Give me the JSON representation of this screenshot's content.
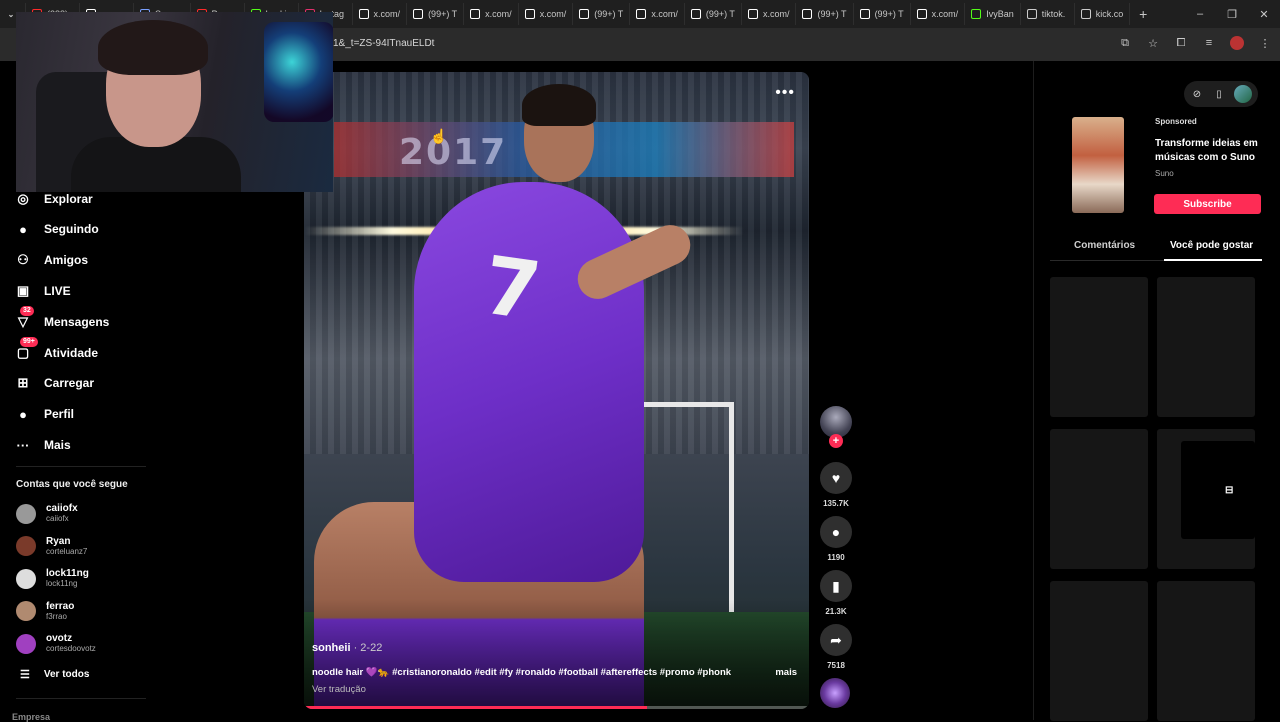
{
  "browser": {
    "tabs": [
      {
        "label": "(288)",
        "icon": "youtube-icon",
        "color": "#ff2a2a"
      },
      {
        "label": "",
        "icon": "tiktok-icon",
        "color": "#ffffff"
      },
      {
        "label": "Screen",
        "icon": "generic-icon",
        "color": "#7aa0ff"
      },
      {
        "label": "Provo",
        "icon": "youtube-icon",
        "color": "#ff2a2a"
      },
      {
        "label": "Lockin",
        "icon": "kick-icon",
        "color": "#53fc18"
      },
      {
        "label": "Instag",
        "icon": "instagram-icon",
        "color": "#e1306c"
      },
      {
        "label": "x.com/",
        "icon": "x-icon",
        "color": "#ffffff"
      },
      {
        "label": "(99+) T",
        "icon": "tiktok-icon",
        "color": "#ffffff"
      },
      {
        "label": "x.com/",
        "icon": "x-icon",
        "color": "#ffffff"
      },
      {
        "label": "x.com/",
        "icon": "x-icon",
        "color": "#ffffff"
      },
      {
        "label": "(99+) T",
        "icon": "tiktok-icon",
        "color": "#ffffff"
      },
      {
        "label": "x.com/",
        "icon": "x-icon",
        "color": "#ffffff"
      },
      {
        "label": "(99+) T",
        "icon": "tiktok-icon",
        "color": "#ffffff"
      },
      {
        "label": "x.com/",
        "icon": "x-icon",
        "color": "#ffffff"
      },
      {
        "label": "(99+) T",
        "icon": "tiktok-icon",
        "color": "#ffffff"
      },
      {
        "label": "(99+) T",
        "icon": "tiktok-icon",
        "color": "#ffffff"
      },
      {
        "label": "x.com/",
        "icon": "x-icon",
        "color": "#ffffff"
      },
      {
        "label": "IvyBan",
        "icon": "kick-icon",
        "color": "#53fc18"
      },
      {
        "label": "tiktok.",
        "icon": "globe-icon",
        "color": "#cccccc"
      },
      {
        "label": "kick.co",
        "icon": "link-icon",
        "color": "#cccccc"
      }
    ],
    "new_tab": "+",
    "url": "1&_t=ZS-94ITnauELDt",
    "window_controls": [
      "–",
      "❐",
      "✕"
    ]
  },
  "sidebar": {
    "nav": [
      {
        "label": "Explorar",
        "icon": "compass-icon",
        "glyph": "◎",
        "badge": ""
      },
      {
        "label": "Seguindo",
        "icon": "following-avatar-icon",
        "glyph": "●",
        "badge": ""
      },
      {
        "label": "Amigos",
        "icon": "friends-icon",
        "glyph": "⚇",
        "badge": ""
      },
      {
        "label": "LIVE",
        "icon": "live-icon",
        "glyph": "▣",
        "badge": ""
      },
      {
        "label": "Mensagens",
        "icon": "messages-icon",
        "glyph": "▽",
        "badge": "32"
      },
      {
        "label": "Atividade",
        "icon": "activity-icon",
        "glyph": "▢",
        "badge": "99+"
      },
      {
        "label": "Carregar",
        "icon": "upload-icon",
        "glyph": "⊞",
        "badge": ""
      },
      {
        "label": "Perfil",
        "icon": "profile-icon",
        "glyph": "●",
        "badge": ""
      },
      {
        "label": "Mais",
        "icon": "more-icon",
        "glyph": "···",
        "badge": ""
      }
    ],
    "following_title": "Contas que você segue",
    "accounts": [
      {
        "name": "caiiofx",
        "handle": "caiiofx",
        "color": "#999999"
      },
      {
        "name": "Ryan",
        "handle": "corteluanz7",
        "color": "#7a3a2a"
      },
      {
        "name": "lock11ng",
        "handle": "lock11ng",
        "color": "#dddddd"
      },
      {
        "name": "ferrao",
        "handle": "f3rrao",
        "color": "#b08a70"
      },
      {
        "name": "ovotz",
        "handle": "cortesdoovotz",
        "color": "#a040c0"
      }
    ],
    "see_all": "Ver todos",
    "footer": "Empresa"
  },
  "video": {
    "author": "sonheii",
    "date": " · 2-22",
    "caption": "noodle hair 💜🐆 #cristianoronaldo #edit #fy #ronaldo #football #aftereffects #promo #phonk",
    "more": "mais",
    "translate": "Ver tradução",
    "scene_banner": "2017",
    "jersey_number": "7",
    "progress": 0.68
  },
  "actions": {
    "likes": "135.7K",
    "comments": "1190",
    "saves": "21.3K",
    "shares": "7518"
  },
  "right_panel": {
    "sponsored": "Sponsored",
    "ad_title": "Transforme ideias em músicas com o Suno",
    "ad_brand": "Suno",
    "ad_button": "Subscribe",
    "tabs": [
      "Comentários",
      "Você pode gostar"
    ],
    "active_tab": 1
  },
  "colors": {
    "accent": "#fe2c55",
    "background": "#000000",
    "jersey": "#6e2fc8"
  }
}
